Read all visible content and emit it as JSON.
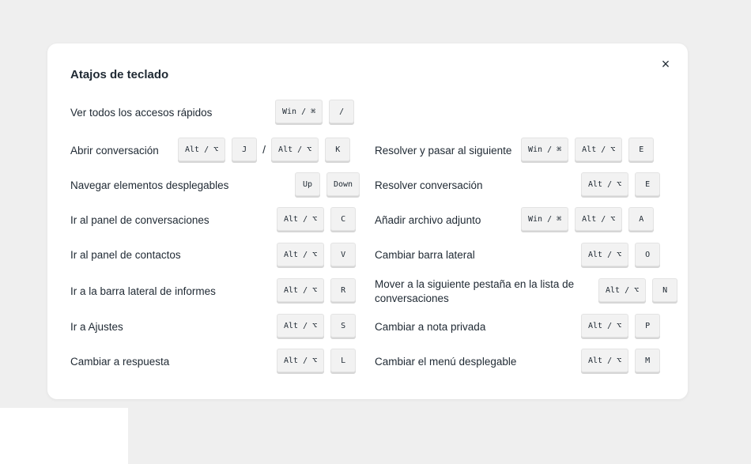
{
  "modal": {
    "title": "Atajos de teclado",
    "close_label": "×"
  },
  "keys": {
    "win_cmd": "Win / ⌘",
    "alt_opt": "Alt / ⌥",
    "slash": "/",
    "up": "Up",
    "down": "Down"
  },
  "left": [
    {
      "label": "Ver todos los accesos rápidos",
      "keys": [
        "Win / ⌘",
        "/"
      ]
    },
    {
      "label": "Abrir conversación",
      "keys": [
        "Alt / ⌥",
        "J",
        "/",
        "Alt / ⌥",
        "K"
      ]
    },
    {
      "label": "Navegar elementos desplegables",
      "keys": [
        "Up",
        "Down"
      ]
    },
    {
      "label": "Ir al panel de conversaciones",
      "keys": [
        "Alt / ⌥",
        "C"
      ]
    },
    {
      "label": "Ir al panel de contactos",
      "keys": [
        "Alt / ⌥",
        "V"
      ]
    },
    {
      "label": "Ir a la barra lateral de informes",
      "keys": [
        "Alt / ⌥",
        "R"
      ]
    },
    {
      "label": "Ir a Ajustes",
      "keys": [
        "Alt / ⌥",
        "S"
      ]
    },
    {
      "label": "Cambiar a respuesta",
      "keys": [
        "Alt / ⌥",
        "L"
      ]
    }
  ],
  "right": [
    {
      "label": "Resolver y pasar al siguiente",
      "keys": [
        "Win / ⌘",
        "Alt / ⌥",
        "E"
      ]
    },
    {
      "label": "Resolver conversación",
      "keys": [
        "Alt / ⌥",
        "E"
      ]
    },
    {
      "label": "Añadir archivo adjunto",
      "keys": [
        "Win / ⌘",
        "Alt / ⌥",
        "A"
      ]
    },
    {
      "label": "Cambiar barra lateral",
      "keys": [
        "Alt / ⌥",
        "O"
      ]
    },
    {
      "label_line1": "Mover a la siguiente pestaña en la lista de",
      "label_line2": "conversaciones",
      "keys": [
        "Alt / ⌥",
        "N"
      ]
    },
    {
      "label": "Cambiar a nota privada",
      "keys": [
        "Alt / ⌥",
        "P"
      ]
    },
    {
      "label": "Cambiar el menú desplegable",
      "keys": [
        "Alt / ⌥",
        "M"
      ]
    }
  ]
}
